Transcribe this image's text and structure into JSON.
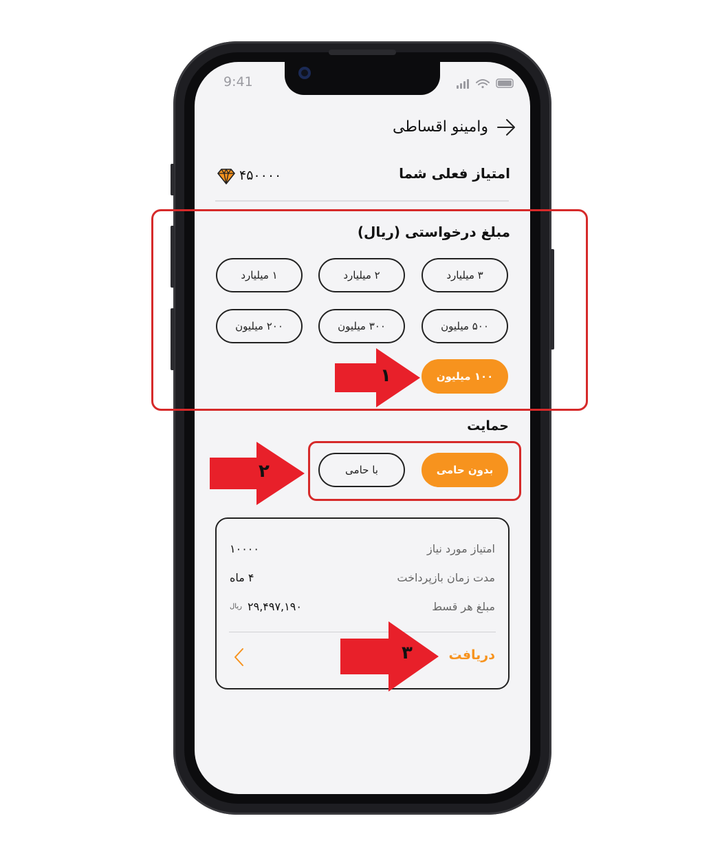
{
  "status_bar": {
    "time": "9:41"
  },
  "header": {
    "title": "وامینو اقساطی",
    "back_icon": "arrow-right-icon"
  },
  "points": {
    "label": "امتیاز فعلی شما",
    "value": "۴۵۰۰۰۰",
    "icon": "diamond-icon"
  },
  "amount": {
    "title": "مبلغ درخواستی (ریال)",
    "options": [
      {
        "label": "۳ میلیارد",
        "active": false
      },
      {
        "label": "۲ میلیارد",
        "active": false
      },
      {
        "label": "۱ میلیارد",
        "active": false
      },
      {
        "label": "۵۰۰ میلیون",
        "active": false
      },
      {
        "label": "۳۰۰ میلیون",
        "active": false
      },
      {
        "label": "۲۰۰ میلیون",
        "active": false
      },
      {
        "label": "۱۰۰ میلیون",
        "active": true
      }
    ]
  },
  "support": {
    "title": "حمایت",
    "options": [
      {
        "label": "بدون حامی",
        "active": true
      },
      {
        "label": "با حامی",
        "active": false
      }
    ]
  },
  "summary": {
    "rows": [
      {
        "label": "امتیاز مورد نیاز",
        "value": "۱۰۰۰۰"
      },
      {
        "label": "مدت زمان بازپرداخت",
        "value": "۴ ماه"
      },
      {
        "label": "مبلغ هر قسط",
        "value": "۲۹,۴۹۷,۱۹۰",
        "unit": "ریال"
      }
    ],
    "action_label": "دریافت"
  },
  "annotations": {
    "step1": "۱",
    "step2": "۲",
    "step3": "۳"
  },
  "colors": {
    "accent": "#f7931e",
    "annotation_red": "#e8202a",
    "box_red": "#d62a2a",
    "screen_bg": "#f4f4f6"
  }
}
